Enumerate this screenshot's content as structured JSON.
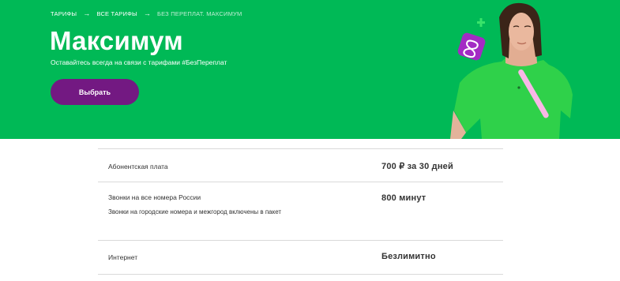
{
  "breadcrumb": {
    "items": [
      "ТАРИФЫ",
      "ВСЕ ТАРИФЫ",
      "БЕЗ ПЕРЕПЛАТ. МАКСИМУМ"
    ],
    "separator": "→"
  },
  "hero": {
    "title": "Максимум",
    "subtitle": "Оставайтесь всегда на связи с тарифами #БезПереплат",
    "button_label": "Выбрать",
    "illustration": {
      "icons": [
        "plus-icon",
        "infinity-icon"
      ],
      "image": "woman-in-green-shirt"
    }
  },
  "tariff": {
    "rows": [
      {
        "label": "Абонентская плата",
        "value": "700 ₽ за 30 дней"
      },
      {
        "label": "Звонки на все номера России",
        "value": "800 минут",
        "note": "Звонки на городские номера и межгород включены в пакет"
      },
      {
        "label": "Интернет",
        "value": "Безлимитно"
      }
    ]
  },
  "colors": {
    "brand_green": "#00b956",
    "brand_purple": "#731982",
    "accent_pink": "#f5a3e0"
  }
}
